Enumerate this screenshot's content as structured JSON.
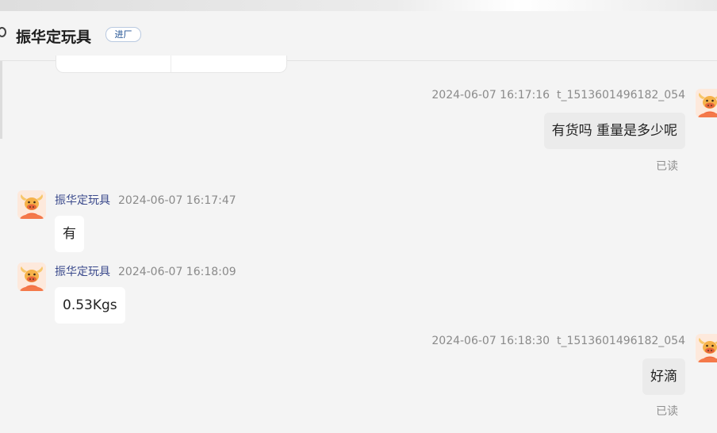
{
  "header": {
    "title": "振华定玩具",
    "tag": "进厂"
  },
  "messages": [
    {
      "direction": "out",
      "time": "2024-06-07 16:17:16",
      "sender_id": "t_1513601496182_054",
      "text": "有货吗 重量是多少呢",
      "status": "已读"
    },
    {
      "direction": "in",
      "sender": "振华定玩具",
      "time": "2024-06-07 16:17:47",
      "text": "有"
    },
    {
      "direction": "in",
      "sender": "振华定玩具",
      "time": "2024-06-07 16:18:09",
      "text": "0.53Kgs"
    },
    {
      "direction": "out",
      "time": "2024-06-07 16:18:30",
      "sender_id": "t_1513601496182_054",
      "text": "好滴",
      "status": "已读"
    }
  ],
  "avatar_icon": "cartoon-bull-avatar-icon",
  "colors": {
    "background": "#f4f4f4",
    "sender_name": "#3b4a8c",
    "tag_text": "#1d4f91",
    "avatar_orange": "#f26a3c"
  }
}
